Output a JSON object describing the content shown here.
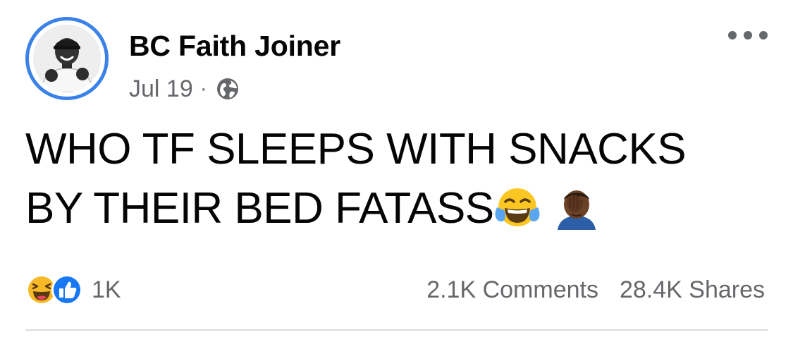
{
  "post": {
    "author": "BC Faith Joiner",
    "date": "Jul 19",
    "separator": "·",
    "privacy_icon": "globe-icon",
    "more_icon": "more-horizontal-icon",
    "text_line_1": "WHO TF SLEEPS WITH SNACKS",
    "text_line_2": "BY THEIR BED FATASS",
    "emojis": [
      "face-with-tears-of-joy",
      "man-facepalming-dark-skin"
    ]
  },
  "stats": {
    "reaction_icons": [
      "haha-reaction-icon",
      "like-reaction-icon"
    ],
    "reaction_count": "1K",
    "comments": "2.1K Comments",
    "shares": "28.4K Shares"
  },
  "colors": {
    "avatar_ring": "#3b82e8",
    "secondary_text": "#65676b",
    "like_blue": "#1877f2",
    "haha_yellow": "#f7b928",
    "divider": "#dadde1"
  }
}
